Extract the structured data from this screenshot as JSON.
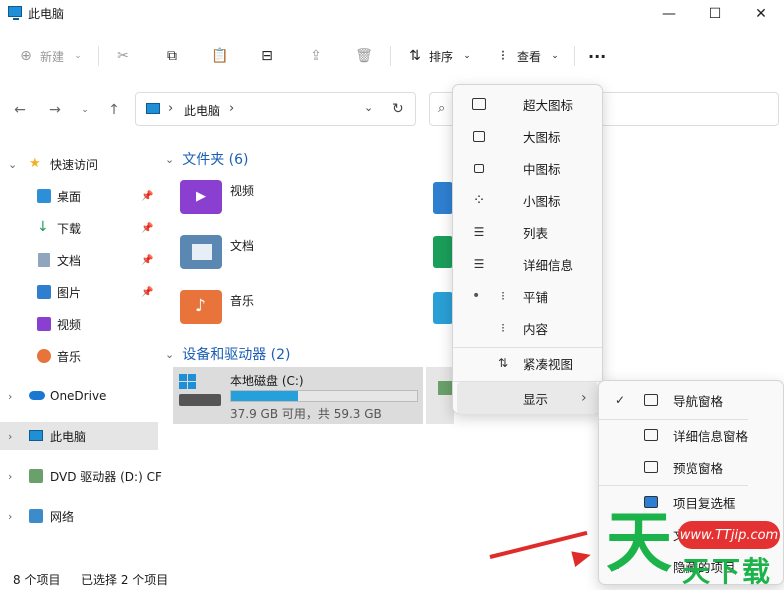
{
  "window": {
    "title": "此电脑",
    "minimize": "—",
    "maximize": "☐",
    "close": "✕"
  },
  "toolbar": {
    "new_label": "新建",
    "sort_label": "排序",
    "view_label": "查看",
    "more": "···"
  },
  "address": {
    "path": "此电脑"
  },
  "sidebar": {
    "quick_access": "快速访问",
    "items": [
      {
        "label": "桌面"
      },
      {
        "label": "下载"
      },
      {
        "label": "文档"
      },
      {
        "label": "图片"
      },
      {
        "label": "视频"
      },
      {
        "label": "音乐"
      }
    ],
    "onedrive": "OneDrive",
    "this_pc": "此电脑",
    "dvd": "DVD 驱动器 (D:) CF",
    "network": "网络"
  },
  "content": {
    "folders_head": "文件夹 (6)",
    "folders": [
      {
        "label": "视频",
        "color": "#8b3fd1"
      },
      {
        "label": "文档",
        "color": "#5b87b3"
      },
      {
        "label": "音乐",
        "color": "#e8743b"
      }
    ],
    "devices_head": "设备和驱动器 (2)",
    "drive": {
      "name": "本地磁盘 (C:)",
      "free": "37.9 GB 可用，共 59.3 GB",
      "used_fraction": 0.36
    }
  },
  "status": {
    "items": "8 个项目",
    "selected": "已选择 2 个项目"
  },
  "view_menu": {
    "items": [
      {
        "label": "超大图标",
        "icon": "□"
      },
      {
        "label": "大图标",
        "icon": "□"
      },
      {
        "label": "中图标",
        "icon": "▭"
      },
      {
        "label": "小图标",
        "icon": "⁘"
      },
      {
        "label": "列表",
        "icon": "☰"
      },
      {
        "label": "详细信息",
        "icon": "☰"
      },
      {
        "label": "平铺",
        "icon": "⁝"
      },
      {
        "label": "内容",
        "icon": "⁝"
      },
      {
        "label": "紧凑视图",
        "icon": "⇅"
      },
      {
        "label": "显示",
        "icon": ""
      }
    ],
    "selected_marker": "•",
    "submenu_arrow": "›"
  },
  "show_menu": {
    "items": [
      {
        "label": "导航窗格",
        "checked": "✓"
      },
      {
        "label": "详细信息窗格",
        "checked": ""
      },
      {
        "label": "预览窗格",
        "checked": ""
      },
      {
        "label": "项目复选框",
        "checked": ""
      },
      {
        "label": "文",
        "checked": ""
      },
      {
        "label": "隐藏的项目",
        "checked": "✓"
      }
    ]
  },
  "watermark": {
    "url": "www.TTjip.com",
    "big": "天",
    "text": "天下载"
  }
}
